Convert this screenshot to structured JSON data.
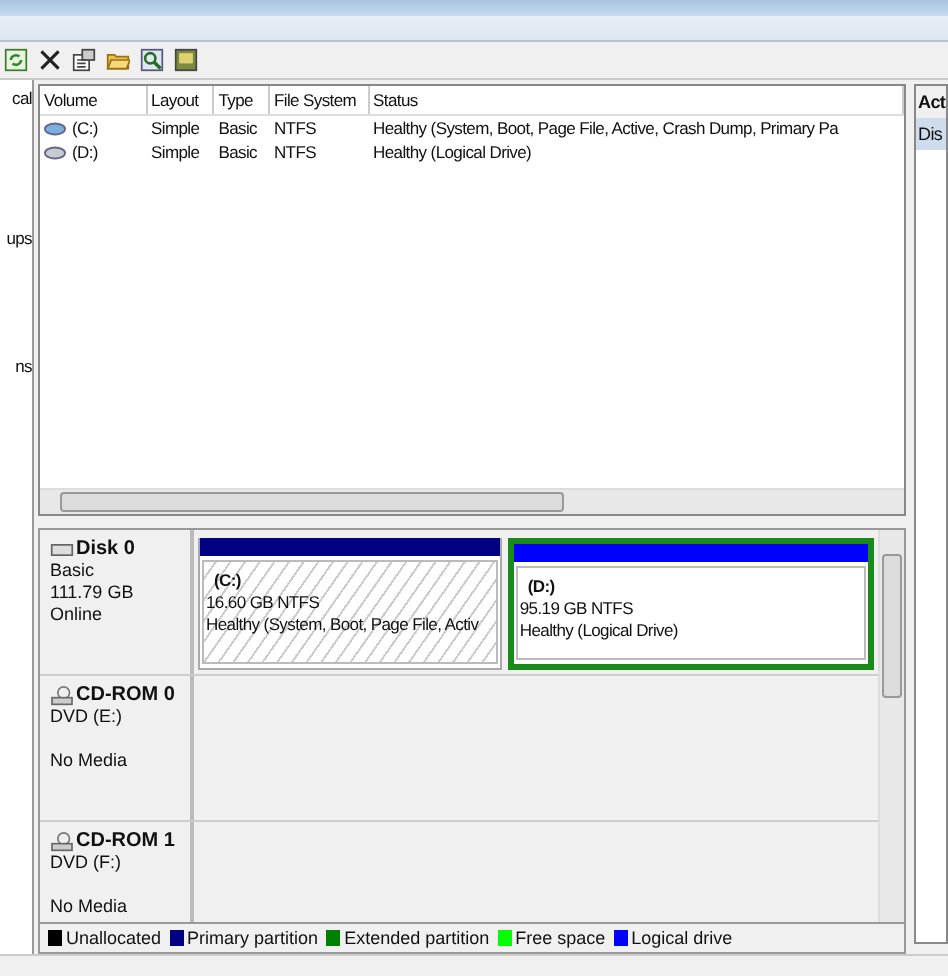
{
  "left_nav": {
    "items": [
      "cal",
      "ups",
      "ns"
    ]
  },
  "volume_list": {
    "columns": [
      "Volume",
      "Layout",
      "Type",
      "File System",
      "Status"
    ],
    "rows": [
      {
        "cells": [
          "(C:)",
          "Simple",
          "Basic",
          "NTFS",
          "Healthy (System, Boot, Page File, Active, Crash Dump, Primary Pa"
        ],
        "selected": false
      },
      {
        "cells": [
          "(D:)",
          "Simple",
          "Basic",
          "NTFS",
          "Healthy (Logical Drive)"
        ],
        "selected": false
      }
    ]
  },
  "disks": [
    {
      "kind": "disk",
      "name": "Disk 0",
      "lines": [
        "Basic",
        "111.79 GB",
        "Online"
      ],
      "partitions": [
        {
          "name": "(C:)",
          "size": "16.60 GB NTFS",
          "status": "Healthy (System, Boot, Page File, Activ",
          "color": "#000080",
          "selected": false
        },
        {
          "name": "(D:)",
          "size": "95.19 GB NTFS",
          "status": "Healthy (Logical Drive)",
          "color": "#0000ff",
          "selected": true
        }
      ]
    },
    {
      "kind": "cdrom",
      "name": "CD-ROM 0",
      "lines": [
        "DVD (E:)",
        "No Media"
      ]
    },
    {
      "kind": "cdrom",
      "name": "CD-ROM 1",
      "lines": [
        "DVD (F:)",
        "No Media"
      ]
    }
  ],
  "legend": [
    {
      "label": "Unallocated",
      "color": "#000000"
    },
    {
      "label": "Primary partition",
      "color": "#000080"
    },
    {
      "label": "Extended partition",
      "color": "#008000"
    },
    {
      "label": "Free space",
      "color": "#00ff00"
    },
    {
      "label": "Logical drive",
      "color": "#0000ff"
    }
  ],
  "actions": {
    "header": "Act",
    "items": [
      {
        "label": "Dis",
        "selected": true
      }
    ]
  }
}
